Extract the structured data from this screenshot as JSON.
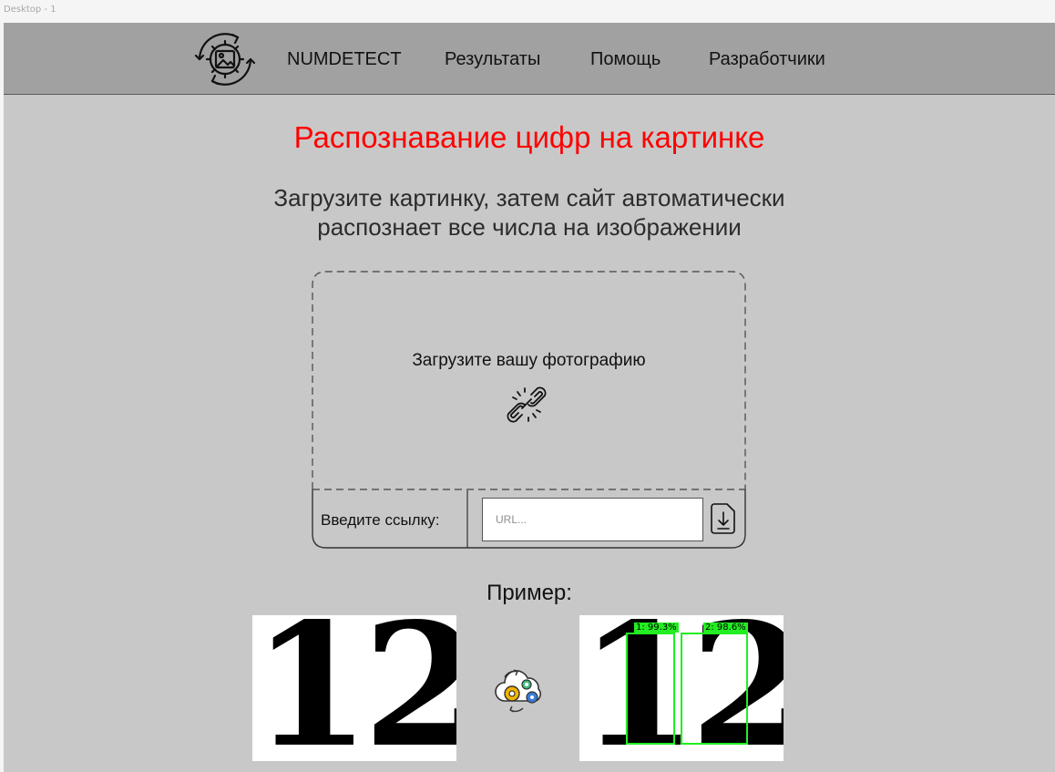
{
  "frame": {
    "label": "Desktop - 1"
  },
  "nav": {
    "brand": "NUMDETECT",
    "items": [
      "Результаты",
      "Помощь",
      "Разработчики"
    ]
  },
  "hero": {
    "title": "Распознавание цифр на картинке",
    "subtitle_line1": "Загрузите картинку, затем сайт автоматически",
    "subtitle_line2": "распознает все числа на изображении"
  },
  "upload": {
    "prompt": "Загрузите вашу фотографию",
    "url_label": "Введите ссылку:",
    "url_placeholder": "URL...",
    "url_value": ""
  },
  "example": {
    "label": "Пример:",
    "input_digits": "12",
    "output_digits": "12",
    "detections": [
      "1: 99.3%",
      "2: 98.6%"
    ]
  },
  "colors": {
    "title": "#ff0000",
    "navbar": "#a1a1a1",
    "page_bg": "#c8c8c8",
    "detection": "#22ee22"
  }
}
